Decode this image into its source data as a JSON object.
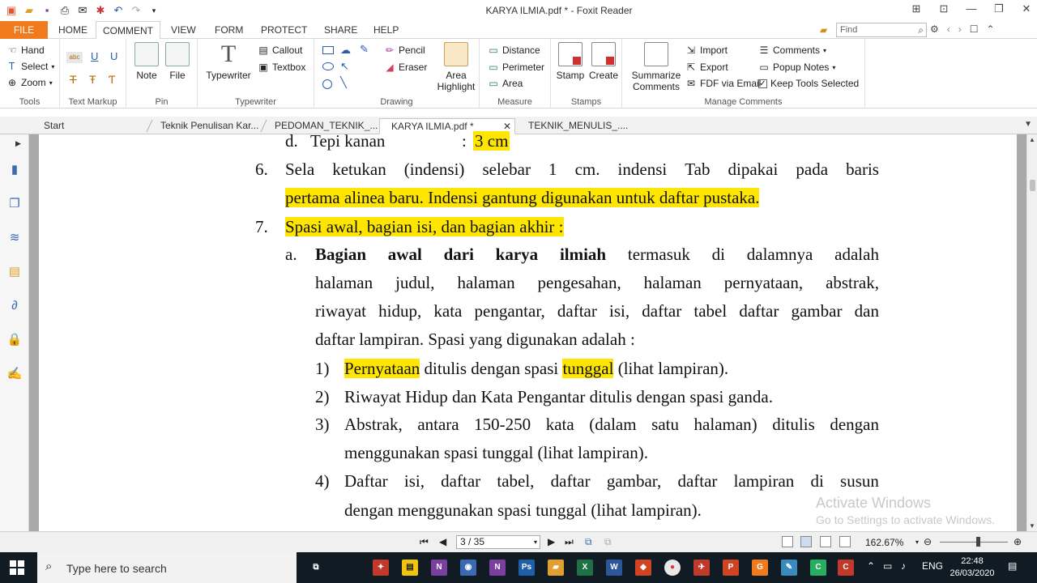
{
  "window": {
    "title": "KARYA ILMIA.pdf * - Foxit Reader"
  },
  "ribbon_tabs": [
    "FILE",
    "HOME",
    "COMMENT",
    "VIEW",
    "FORM",
    "PROTECT",
    "SHARE",
    "HELP"
  ],
  "find": {
    "placeholder": "Find"
  },
  "groups": {
    "tools": {
      "label": "Tools",
      "hand": "Hand",
      "select": "Select",
      "zoom": "Zoom"
    },
    "text_markup": {
      "label": "Text Markup"
    },
    "pin": {
      "label": "Pin",
      "note": "Note",
      "file": "File"
    },
    "typewriter": {
      "label": "Typewriter",
      "typewriter": "Typewriter",
      "callout": "Callout",
      "textbox": "Textbox"
    },
    "drawing": {
      "label": "Drawing",
      "pencil": "Pencil",
      "eraser": "Eraser",
      "area_highlight_1": "Area",
      "area_highlight_2": "Highlight"
    },
    "measure": {
      "label": "Measure",
      "distance": "Distance",
      "perimeter": "Perimeter",
      "area": "Area"
    },
    "stamps": {
      "label": "Stamps",
      "stamp": "Stamp",
      "create": "Create"
    },
    "manage": {
      "label": "Manage Comments",
      "summarize_1": "Summarize",
      "summarize_2": "Comments",
      "import": "Import",
      "export": "Export",
      "fdf": "FDF via Email",
      "comments": "Comments",
      "popup": "Popup Notes",
      "keep": "Keep Tools Selected"
    }
  },
  "doc_tabs": [
    "Start",
    "Teknik Penulisan Kar...",
    "PEDOMAN_TEKNIK_...",
    "KARYA ILMIA.pdf *",
    "TEKNIK_MENULIS_...."
  ],
  "document": {
    "l1_prefix": "d.",
    "l1_label": "Tepi kanan",
    "l1_colon": ":",
    "l1_value": "3 cm",
    "l2_num": "6.",
    "l2_words": [
      "Sela",
      "ketukan",
      "(indensi)",
      "selebar",
      "1",
      "cm.",
      "indensi",
      "Tab",
      "dipakai",
      "pada",
      "baris"
    ],
    "l3": "pertama alinea baru. Indensi gantung digunakan untuk daftar pustaka.",
    "l4_num": "7.",
    "l4": "Spasi awal, bagian isi, dan bagian akhir :",
    "l5_num": "a.",
    "l5_bold": [
      "Bagian",
      "awal",
      "dari",
      "karya",
      "ilmiah"
    ],
    "l5_rest": [
      "termasuk",
      "di",
      "dalamnya",
      "adalah"
    ],
    "l6_words": [
      "halaman",
      "judul,",
      "halaman",
      "pengesahan,",
      "halaman",
      "pernyataan,",
      "abstrak,"
    ],
    "l7_words": [
      "riwayat",
      "hidup,",
      "kata",
      "pengantar,",
      "daftar",
      "isi,",
      "daftar",
      "tabel",
      "daftar",
      "gambar",
      "dan"
    ],
    "l8": "daftar lampiran. Spasi yang digunakan adalah :",
    "l9_num": "1)",
    "l9_hl1": "Pernyataan",
    "l9_mid": " ditulis dengan spasi ",
    "l9_hl2": "tunggal",
    "l9_end": " (lihat lampiran).",
    "l10_num": "2)",
    "l10": "Riwayat Hidup dan Kata Pengantar ditulis dengan spasi ganda.",
    "l11_num": "3)",
    "l11_words": [
      "Abstrak,",
      "antara",
      "150-250",
      "kata",
      "(dalam",
      "satu",
      "halaman)",
      "ditulis",
      "dengan"
    ],
    "l12": "menggunakan spasi tunggal (lihat lampiran).",
    "l13_num": "4)",
    "l13_words": [
      "Daftar",
      "isi,",
      "daftar",
      "tabel,",
      "daftar",
      "gambar,",
      "daftar",
      "lampiran",
      "di",
      "susun"
    ],
    "l14": "dengan menggunakan spasi tunggal (lihat lampiran)."
  },
  "watermark": {
    "line1": "Activate Windows",
    "line2": "Go to Settings to activate Windows."
  },
  "status": {
    "page": "3 / 35",
    "zoom": "162.67%"
  },
  "taskbar": {
    "search_placeholder": "Type here to search",
    "lang": "ENG",
    "time": "22:48",
    "date": "26/03/2020"
  }
}
